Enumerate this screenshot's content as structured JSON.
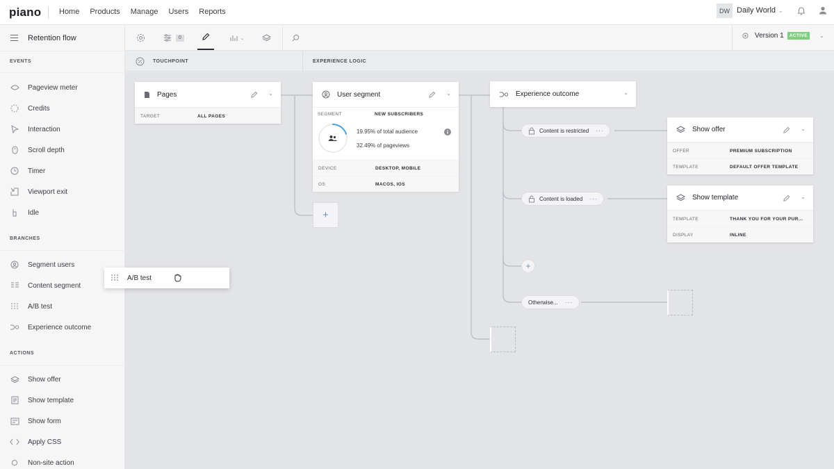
{
  "app": {
    "logo": "piano"
  },
  "nav": {
    "items": [
      "Home",
      "Products",
      "Manage",
      "Users",
      "Reports"
    ]
  },
  "account": {
    "initials": "DW",
    "site": "Daily World"
  },
  "sidebar": {
    "title": "Retention flow",
    "sections": [
      {
        "label": "EVENTS",
        "items": [
          "Pageview meter",
          "Credits",
          "Interaction",
          "Scroll depth",
          "Timer",
          "Viewport exit",
          "Idle"
        ]
      },
      {
        "label": "BRANCHES",
        "items": [
          "Segment users",
          "Content segment",
          "A/B test",
          "Experience outcome"
        ]
      },
      {
        "label": "ACTIONS",
        "items": [
          "Show offer",
          "Show template",
          "Show form",
          "Apply CSS",
          "Non-site action"
        ]
      }
    ]
  },
  "toolbar": {
    "count_badge": "0",
    "version_label": "Version 1",
    "status": "ACTIVE"
  },
  "columns": {
    "touchpoint": "TOUCHPOINT",
    "experience_logic": "EXPERIENCE LOGIC"
  },
  "drag_item": {
    "label": "A/B test"
  },
  "cards": {
    "pages": {
      "title": "Pages",
      "rows": [
        {
          "key": "TARGET",
          "value": "ALL PAGES"
        }
      ]
    },
    "user_segment": {
      "title": "User segment",
      "segment_key": "SEGMENT",
      "segment_value": "NEW SUBSCRIBERS",
      "audience_pct": "19.95%",
      "audience_text": " of total audience",
      "pageviews_pct": "32.49%",
      "pageviews_text": " of pageviews",
      "audience_fraction": 0.1995,
      "rows": [
        {
          "key": "DEVICE",
          "value": "DESKTOP, MOBILE"
        },
        {
          "key": "OS",
          "value": "MACOS, IOS"
        }
      ]
    },
    "experience_outcome": {
      "title": "Experience outcome"
    },
    "show_offer": {
      "title": "Show offer",
      "rows": [
        {
          "key": "OFFER",
          "value": "PREMIUM SUBSCRIPTION"
        },
        {
          "key": "TEMPLATE",
          "value": "DEFAULT OFFER TEMPLATE"
        }
      ]
    },
    "show_template": {
      "title": "Show template",
      "rows": [
        {
          "key": "TEMPLATE",
          "value": "THANK YOU FOR YOUR PUR..."
        },
        {
          "key": "DISPLAY",
          "value": "INLINE"
        }
      ]
    }
  },
  "branches": {
    "restricted": "Content is restricted",
    "loaded": "Content is loaded",
    "otherwise": "Otherwise..."
  },
  "colors": {
    "active_green": "#7fd07e",
    "progress_blue": "#4aa3df",
    "accent_blue": "#5a8ec0"
  }
}
